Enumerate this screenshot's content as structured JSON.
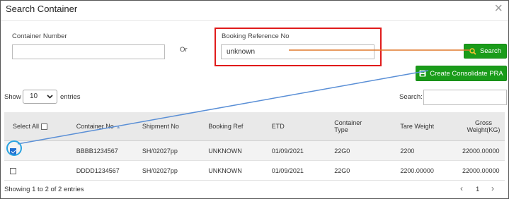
{
  "dialog": {
    "title": "Search Container",
    "close_glyph": "×"
  },
  "search": {
    "container_number_label": "Container Number",
    "container_number_value": "",
    "or_label": "Or",
    "booking_ref_label": "Booking Reference No",
    "booking_ref_value": "unknown",
    "search_button": "Search",
    "create_button": "Create Consolidate PRA"
  },
  "table_controls": {
    "show_label": "Show",
    "page_size": "10",
    "entries_label": "entries",
    "search_label": "Search:",
    "search_value": ""
  },
  "table": {
    "select_all_label": "Select All",
    "headers": [
      "Container No",
      "Shipment No",
      "Booking Ref",
      "ETD",
      "Container Type",
      "Tare Weight",
      "Gross Weight(KG)"
    ],
    "rows": [
      {
        "checked": true,
        "cells": [
          "BBBB1234567",
          "SH/02027pp",
          "UNKNOWN",
          "01/09/2021",
          "22G0",
          "2200",
          "22000.00000"
        ]
      },
      {
        "checked": false,
        "cells": [
          "DDDD1234567",
          "SH/02027pp",
          "UNKNOWN",
          "01/09/2021",
          "22G0",
          "2200.00000",
          "22000.00000"
        ]
      }
    ]
  },
  "footer": {
    "info": "Showing 1 to 2 of 2 entries",
    "prev_glyph": "‹",
    "page": "1",
    "next_glyph": "›"
  },
  "colors": {
    "accent_green": "#1a9c1a",
    "highlight_red": "#e01b1b",
    "arrow_orange": "#e0792b",
    "arrow_blue": "#5a8fd6",
    "circle_blue": "#29a3e0"
  }
}
